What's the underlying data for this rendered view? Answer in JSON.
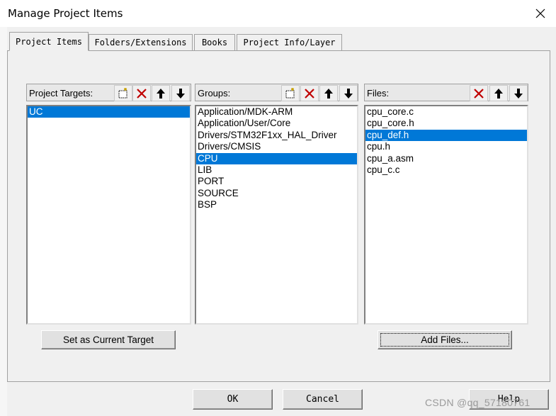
{
  "window": {
    "title": "Manage Project Items"
  },
  "tabs": [
    {
      "label": "Project Items"
    },
    {
      "label": "Folders/Extensions"
    },
    {
      "label": "Books"
    },
    {
      "label": "Project Info/Layer"
    }
  ],
  "targets": {
    "label": "Project Targets:",
    "items": [
      "UC"
    ],
    "selected": "UC"
  },
  "groups": {
    "label": "Groups:",
    "items": [
      "Application/MDK-ARM",
      "Application/User/Core",
      "Drivers/STM32F1xx_HAL_Driver",
      "Drivers/CMSIS",
      "CPU",
      "LIB",
      "PORT",
      "SOURCE",
      "BSP"
    ],
    "selected": "CPU"
  },
  "files": {
    "label": "Files:",
    "items": [
      "cpu_core.c",
      "cpu_core.h",
      "cpu_def.h",
      "cpu.h",
      "cpu_a.asm",
      "cpu_c.c"
    ],
    "selected": "cpu_def.h"
  },
  "buttons": {
    "set_target": "Set as Current Target",
    "add_files": "Add Files...",
    "ok": "OK",
    "cancel": "Cancel",
    "help": "Help"
  },
  "watermark": "CSDN @qq_57180761",
  "colors": {
    "selection": "#0078d7",
    "delete_icon": "#c00000"
  },
  "icons": [
    "new-icon",
    "delete-icon",
    "move-up-icon",
    "move-down-icon",
    "close-icon"
  ]
}
